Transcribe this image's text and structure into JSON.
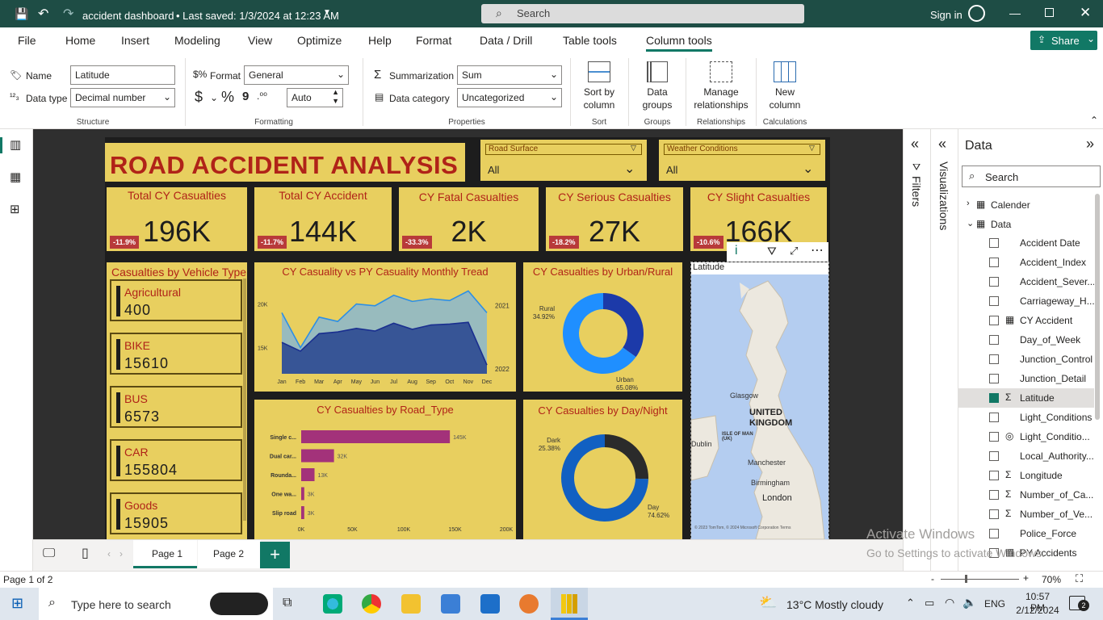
{
  "titlebar": {
    "doc_title": "accident dashboard",
    "saved": "• Last saved: 1/3/2024 at 12:23 AM",
    "search_placeholder": "Search",
    "signin": "Sign in"
  },
  "tabs": [
    "File",
    "Home",
    "Insert",
    "Modeling",
    "View",
    "Optimize",
    "Help",
    "Format",
    "Data / Drill",
    "Table tools",
    "Column tools"
  ],
  "share_label": "Share",
  "ribbon": {
    "name_label": "Name",
    "name_value": "Latitude",
    "datatype_label": "Data type",
    "datatype_value": "Decimal number",
    "format_label": "Format",
    "format_value": "General",
    "auto_value": "Auto",
    "summ_label": "Summarization",
    "summ_value": "Sum",
    "datacat_label": "Data category",
    "datacat_value": "Uncategorized",
    "sortby_label": "Sort by column",
    "datagroups_label": "Data groups",
    "manage_label": "Manage relationships",
    "newcol_label": "New column",
    "groups": [
      "Structure",
      "Formatting",
      "Properties",
      "Sort",
      "Groups",
      "Relationships",
      "Calculations"
    ]
  },
  "report": {
    "title": "ROAD ACCIDENT ANALYSIS",
    "slicers": [
      {
        "label": "Road Surface",
        "value": "All"
      },
      {
        "label": "Weather Conditions",
        "value": "All"
      }
    ],
    "kpis": [
      {
        "title": "Total CY Casualties",
        "value": "196K",
        "change": "-11.9%"
      },
      {
        "title": "Total CY Accident",
        "value": "144K",
        "change": "-11.7%"
      },
      {
        "title": "CY Fatal Casualties",
        "value": "2K",
        "change": "-33.3%"
      },
      {
        "title": "CY Serious Casualties",
        "value": "27K",
        "change": "-18.2%"
      },
      {
        "title": "CY Slight Casualties",
        "value": "166K",
        "change": "-10.6%"
      }
    ],
    "vehicle_title": "Casualties by Vehicle Type",
    "vehicles": [
      {
        "name": "Agricultural",
        "value": "400"
      },
      {
        "name": "BIKE",
        "value": "15610"
      },
      {
        "name": "BUS",
        "value": "6573"
      },
      {
        "name": "CAR",
        "value": "155804"
      },
      {
        "name": "Goods",
        "value": "15905"
      }
    ],
    "map_title": "Latitude",
    "map_labels": [
      "Glasgow",
      "UNITED KINGDOM",
      "ISLE OF MAN (UK)",
      "Dublin",
      "Manchester",
      "Birmingham",
      "London"
    ],
    "map_credit": "© 2023 TomTom, © 2024 Microsoft Corporation Terms"
  },
  "chart_data": [
    {
      "type": "area",
      "title": "CY Casuality vs PY Casuality Monthly Tread",
      "categories": [
        "Jan",
        "Feb",
        "Mar",
        "Apr",
        "May",
        "Jun",
        "Jul",
        "Aug",
        "Sep",
        "Oct",
        "Nov",
        "Dec"
      ],
      "y_ticks": [
        "20K",
        "15K"
      ],
      "ylim": [
        12000,
        22000
      ],
      "series": [
        {
          "name": "2021",
          "values": [
            19000,
            15000,
            18500,
            18000,
            20000,
            19800,
            21000,
            20300,
            20600,
            20400,
            21500,
            19000
          ]
        },
        {
          "name": "2022",
          "values": [
            15600,
            14600,
            16600,
            16800,
            17200,
            16900,
            17800,
            17100,
            17600,
            17700,
            17900,
            13000
          ]
        }
      ],
      "colors": [
        "#8fb8c9",
        "#1f3c8c"
      ]
    },
    {
      "type": "pie",
      "title": "CY Casualties by Urban/Rural",
      "labels": [
        "Rural",
        "Urban"
      ],
      "values": [
        34.92,
        65.08
      ],
      "data_labels": [
        "Rural 34.92%",
        "Urban 65.08%"
      ],
      "colors": [
        "#1c3aa9",
        "#1f8fff"
      ]
    },
    {
      "type": "bar",
      "title": "CY Casualties by Road_Type",
      "categories": [
        "Single c...",
        "Dual car...",
        "Rounda...",
        "One wa...",
        "Slip road"
      ],
      "values": [
        145,
        32,
        13,
        3,
        3
      ],
      "data_labels": [
        "145K",
        "32K",
        "13K",
        "3K",
        "3K"
      ],
      "x_ticks": [
        "0K",
        "50K",
        "100K",
        "150K",
        "200K"
      ],
      "xlim": [
        0,
        200
      ],
      "color": "#a3327a"
    },
    {
      "type": "pie",
      "title": "CY Casualties by Day/Night",
      "labels": [
        "Dark",
        "Day"
      ],
      "values": [
        25.38,
        74.62
      ],
      "data_labels": [
        "Dark 25.38%",
        "Day 74.62%"
      ],
      "colors": [
        "#2b2b2b",
        "#1160c2"
      ]
    }
  ],
  "data_pane": {
    "title": "Data",
    "search_placeholder": "Search",
    "tables": [
      "Calender",
      "Data"
    ],
    "fields": [
      {
        "name": "Accident Date",
        "icon": "",
        "checked": false
      },
      {
        "name": "Accident_Index",
        "icon": "",
        "checked": false
      },
      {
        "name": "Accident_Sever...",
        "icon": "",
        "checked": false
      },
      {
        "name": "Carriageway_H...",
        "icon": "",
        "checked": false
      },
      {
        "name": "CY Accident",
        "icon": "▦",
        "checked": false
      },
      {
        "name": "Day_of_Week",
        "icon": "",
        "checked": false
      },
      {
        "name": "Junction_Control",
        "icon": "",
        "checked": false
      },
      {
        "name": "Junction_Detail",
        "icon": "",
        "checked": false
      },
      {
        "name": "Latitude",
        "icon": "Σ",
        "checked": true
      },
      {
        "name": "Light_Conditions",
        "icon": "",
        "checked": false
      },
      {
        "name": "Light_Conditio...",
        "icon": "◎",
        "checked": false
      },
      {
        "name": "Local_Authority...",
        "icon": "",
        "checked": false
      },
      {
        "name": "Longitude",
        "icon": "Σ",
        "checked": false
      },
      {
        "name": "Number_of_Ca...",
        "icon": "Σ",
        "checked": false
      },
      {
        "name": "Number_of_Ve...",
        "icon": "Σ",
        "checked": false
      },
      {
        "name": "Police_Force",
        "icon": "",
        "checked": false
      },
      {
        "name": "PY Accidents",
        "icon": "▦",
        "checked": false
      }
    ]
  },
  "filters_label": "Filters",
  "viz_label": "Visualizations",
  "pages": [
    "Page 1",
    "Page 2"
  ],
  "status": {
    "page": "Page 1 of 2",
    "zoom": "70%"
  },
  "watermark": {
    "line1": "Activate Windows",
    "line2": "Go to Settings to activate Windows."
  },
  "taskbar": {
    "search": "Type here to search",
    "weather": "13°C  Mostly cloudy",
    "lang": "ENG",
    "time": "10:57 PM",
    "date": "2/12/2024",
    "notif": "2"
  }
}
